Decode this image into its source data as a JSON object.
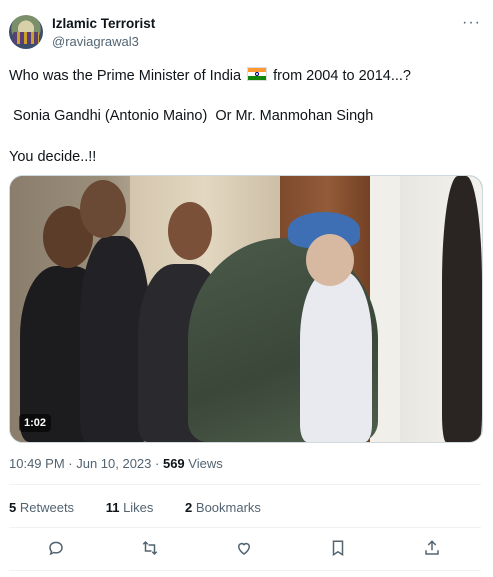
{
  "author": {
    "name": "Izlamic Terrorist",
    "handle": "@raviagrawal3"
  },
  "tweet": {
    "line1_before_flag": "Who was the Prime Minister of India ",
    "line1_after_flag": " from 2004 to 2014...?",
    "line2": " Sonia Gandhi (Antonio Maino)  Or Mr. Manmohan Singh",
    "line3": "You decide..!!"
  },
  "media": {
    "duration": "1:02"
  },
  "meta": {
    "time": "10:49 PM",
    "date": "Jun 10, 2023",
    "views_count": "569",
    "views_label": "Views"
  },
  "stats": {
    "retweets_count": "5",
    "retweets_label": "Retweets",
    "likes_count": "11",
    "likes_label": "Likes",
    "bookmarks_count": "2",
    "bookmarks_label": "Bookmarks"
  },
  "icons": [
    "more-icon",
    "reply-icon",
    "retweet-icon",
    "like-icon",
    "bookmark-icon",
    "share-icon"
  ]
}
